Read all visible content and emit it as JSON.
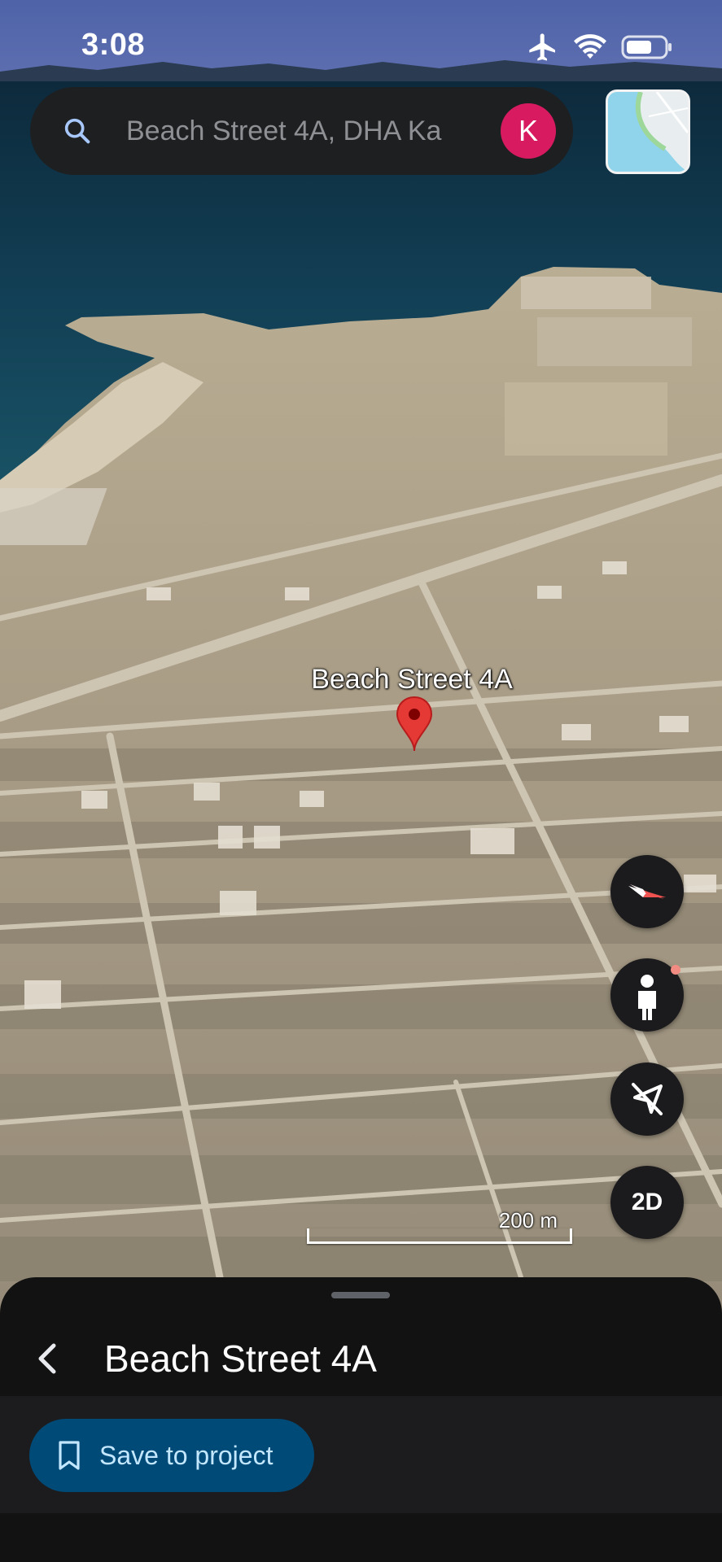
{
  "status_bar": {
    "time": "3:08",
    "icons": [
      "airplane-icon",
      "wifi-icon",
      "battery-icon"
    ]
  },
  "search": {
    "text": "Beach Street 4A, DHA Ka",
    "avatar_letter": "K",
    "avatar_color": "#d81b60"
  },
  "map": {
    "place_label": "Beach Street 4A",
    "pin_color": "#e53935",
    "scale_label": "200 m"
  },
  "controls": {
    "compass": "compass-icon",
    "street_view": "pegman-icon",
    "location": "location-off-icon",
    "view_mode_label": "2D"
  },
  "sheet": {
    "title": "Beach Street 4A",
    "save_label": "Save to project",
    "accent": "#004a77"
  }
}
